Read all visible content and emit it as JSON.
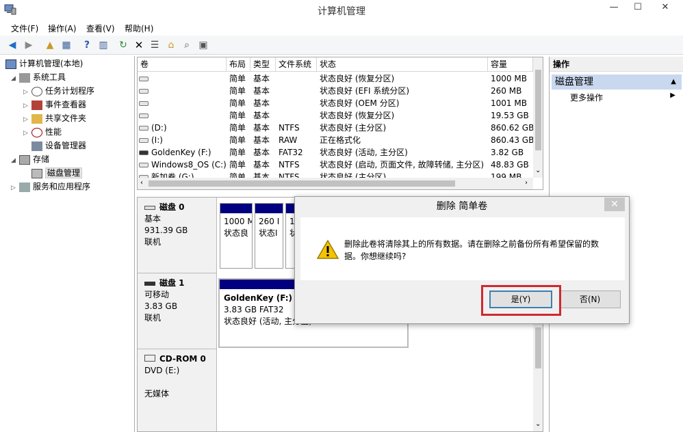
{
  "window": {
    "title": "计算机管理",
    "min": "—",
    "max": "☐",
    "close": "✕"
  },
  "menu": [
    "文件(F)",
    "操作(A)",
    "查看(V)",
    "帮助(H)"
  ],
  "tree": {
    "root": "计算机管理(本地)",
    "system_tools": "系统工具",
    "task_scheduler": "任务计划程序",
    "event_viewer": "事件查看器",
    "shared_folders": "共享文件夹",
    "performance": "性能",
    "device_manager": "设备管理器",
    "storage": "存储",
    "disk_management": "磁盘管理",
    "services": "服务和应用程序"
  },
  "volumes": {
    "headers": [
      "卷",
      "布局",
      "类型",
      "文件系统",
      "状态",
      "容量"
    ],
    "rows": [
      {
        "name": "",
        "layout": "简单",
        "type": "基本",
        "fs": "",
        "status": "状态良好 (恢复分区)",
        "size": "1000 MB",
        "usb": false
      },
      {
        "name": "",
        "layout": "简单",
        "type": "基本",
        "fs": "",
        "status": "状态良好 (EFI 系统分区)",
        "size": "260 MB",
        "usb": false
      },
      {
        "name": "",
        "layout": "简单",
        "type": "基本",
        "fs": "",
        "status": "状态良好 (OEM 分区)",
        "size": "1001 MB",
        "usb": false
      },
      {
        "name": "",
        "layout": "简单",
        "type": "基本",
        "fs": "",
        "status": "状态良好 (恢复分区)",
        "size": "19.53 GB",
        "usb": false
      },
      {
        "name": "(D:)",
        "layout": "简单",
        "type": "基本",
        "fs": "NTFS",
        "status": "状态良好 (主分区)",
        "size": "860.62 GB",
        "usb": false
      },
      {
        "name": "(I:)",
        "layout": "简单",
        "type": "基本",
        "fs": "RAW",
        "status": "正在格式化",
        "size": "860.43 GB",
        "usb": false
      },
      {
        "name": "GoldenKey (F:)",
        "layout": "简单",
        "type": "基本",
        "fs": "FAT32",
        "status": "状态良好 (活动, 主分区)",
        "size": "3.82 GB",
        "usb": true
      },
      {
        "name": "Windows8_OS (C:)",
        "layout": "简单",
        "type": "基本",
        "fs": "NTFS",
        "status": "状态良好 (启动, 页面文件, 故障转储, 主分区)",
        "size": "48.83 GB",
        "usb": false
      },
      {
        "name": "新加卷 (G:)",
        "layout": "简单",
        "type": "基本",
        "fs": "NTFS",
        "status": "状态良好 (主分区)",
        "size": "199 MB",
        "usb": false
      }
    ]
  },
  "disks": [
    {
      "name": "磁盘 0",
      "kind": "基本",
      "size": "931.39 GB",
      "state": "联机"
    },
    {
      "name": "磁盘 1",
      "kind": "可移动",
      "size": "3.83 GB",
      "state": "联机"
    },
    {
      "name": "CD-ROM 0",
      "kind": "DVD (E:)",
      "size": "",
      "state": "无媒体"
    }
  ],
  "partitions_disk0": [
    {
      "size": "1000 M",
      "status": "状态良"
    },
    {
      "size": "260 I",
      "status": "状态I"
    },
    {
      "size": "1(",
      "status": "状"
    }
  ],
  "partition_disk1": {
    "name": "GoldenKey  (F:)",
    "size": "3.83 GB FAT32",
    "status": "状态良好 (活动, 主分区)"
  },
  "actions": {
    "header": "操作",
    "section": "磁盘管理",
    "more": "更多操作"
  },
  "dialog": {
    "title": "删除 简单卷",
    "message_line1": "删除此卷将清除其上的所有数据。请在删除之前备份所有希望保留的数",
    "message_line2": "据。你想继续吗?",
    "yes": "是(Y)",
    "no": "否(N)",
    "close": "✕"
  },
  "colors": {
    "partition_header": "#000080",
    "highlight": "#d0272f",
    "action_section": "#c9d8ee"
  }
}
